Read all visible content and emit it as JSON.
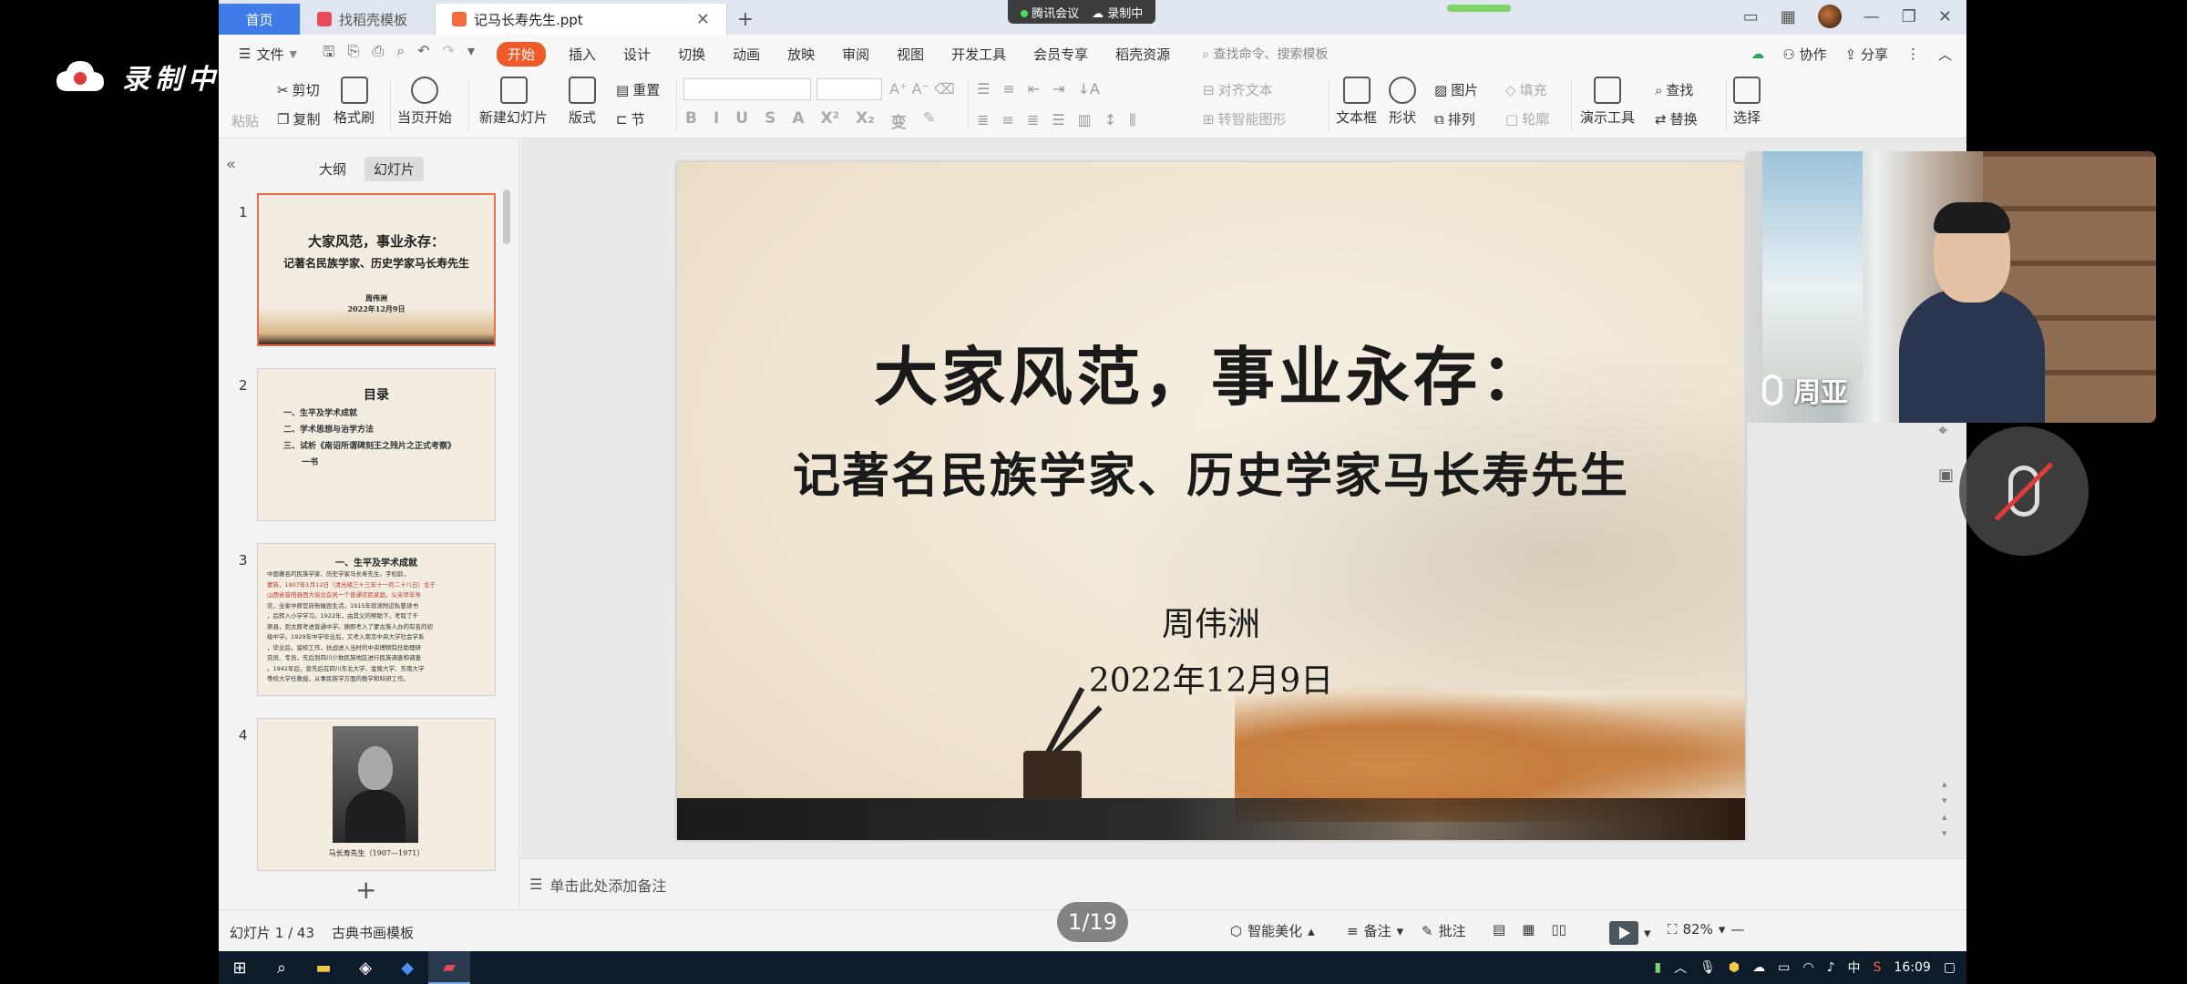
{
  "recording": {
    "label": "录制中"
  },
  "titlebar": {
    "tabs": [
      {
        "label": "首页"
      },
      {
        "label": "找稻壳模板"
      },
      {
        "label": "记马长寿先生.ppt"
      }
    ],
    "meeting": {
      "app": "腾讯会议",
      "status": "录制中"
    }
  },
  "menu": {
    "file": "文件",
    "items": [
      "开始",
      "插入",
      "设计",
      "切换",
      "动画",
      "放映",
      "审阅",
      "视图",
      "开发工具",
      "会员专享",
      "稻壳资源"
    ],
    "search_placeholder": "查找命令、搜索模板",
    "right": [
      "协作",
      "分享"
    ]
  },
  "ribbon": {
    "paste": "粘贴",
    "cut": "剪切",
    "copy": "复制",
    "format_painter": "格式刷",
    "from_current": "当页开始",
    "new_slide": "新建幻灯片",
    "layout": "版式",
    "section": "节",
    "reset": "重置",
    "align_text": "对齐文本",
    "convert_smartart": "转智能图形",
    "textbox": "文本框",
    "shape": "形状",
    "image": "图片",
    "fill": "填充",
    "arrange": "排列",
    "outline": "轮廓",
    "present_tools": "演示工具",
    "find": "查找",
    "replace": "替换",
    "select": "选择"
  },
  "panel": {
    "tabs": [
      "大纲",
      "幻灯片"
    ],
    "thumbs": [
      {
        "num": "1",
        "title": "大家风范，事业永存：",
        "subtitle": "记著名民族学家、历史学家马长寿先生",
        "author": "周伟洲",
        "date": "2022年12月9日"
      },
      {
        "num": "2",
        "title": "目录",
        "items": [
          "一、生平及学术成就",
          "二、学术思想与治学方法",
          "三、试析《南诏所谓碑刻王之残片之正式考察》",
          "一书"
        ]
      },
      {
        "num": "3",
        "title": "一、生平及学术成就",
        "lines": [
          "中国著名的民族学家、历史学家马长寿先生，字松龄，",
          "蒙族，1907年1月12日（清光绪三十三年十一月二十八日）生于",
          "山西省昔阳县西大街北旮旯一个普通农民家庭。父亲早年务",
          "农，全家中原官府衙摧毁生活，1915年就读附近私塾读书",
          "，后转入小学学习。1922年，由其父的帮助下，考取了千",
          "原县，到太原考进普通中学。随即考入了蒙古族人办的有名的初",
          "级中学。1929年中学毕业后，又考入南京中央大学社会学系",
          "，毕业后，留校工作，抗战进入当时的中央博物院任助理研",
          "究员、专员，先后到四川少数民族地区进行民族调查和调查",
          "。1942年后，曾先后在四川东北大学、金陵大学、东南大学",
          "等校大学任教授，从事民族学方面的教学和科研工作。"
        ]
      },
      {
        "num": "4",
        "caption": "马长寿先生（1907—1971）"
      }
    ]
  },
  "slide": {
    "title": "大家风范，事业永存：",
    "subtitle": "记著名民族学家、历史学家马长寿先生",
    "author": "周伟洲",
    "date": "2022年12月9日"
  },
  "notes": {
    "placeholder": "单击此处添加备注"
  },
  "status": {
    "slide_info": "幻灯片 1 / 43",
    "template": "古典书画模板",
    "smart": "智能美化",
    "notes": "备注",
    "comment": "批注",
    "zoom": "82%"
  },
  "pager": "1/19",
  "video": {
    "name": "周亚"
  },
  "taskbar": {
    "time": "16:09",
    "ime": "中"
  }
}
